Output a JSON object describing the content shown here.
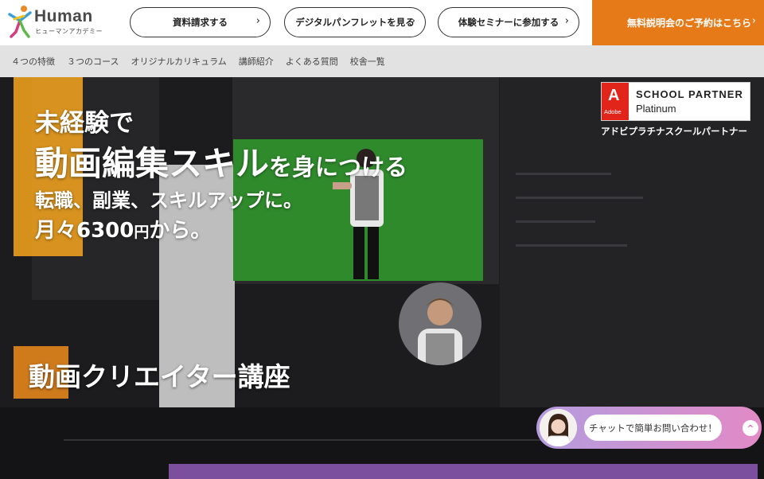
{
  "header": {
    "logo_word": "Human",
    "logo_sub": "ヒューマンアカデミー",
    "buttons": [
      {
        "label": "資料請求する",
        "chevron": "›"
      },
      {
        "label": "デジタルパンフレットを見る",
        "chevron": "›"
      },
      {
        "label": "体験セミナーに参加する",
        "chevron": "›"
      }
    ],
    "cta": {
      "label": "無料説明会のご予約はこちら",
      "chevron": "›",
      "color": "#e77a18"
    }
  },
  "nav": {
    "items": [
      "４つの特徴",
      "３つのコース",
      "オリジナルカリキュラム",
      "講師紹介",
      "よくある質問",
      "校舎一覧"
    ]
  },
  "hero": {
    "line1": "未経験で",
    "line2_big": "動画編集スキル",
    "line2_small": "を身につける",
    "line3": "転職、副業、スキルアップに。",
    "line4_a": "月々6300",
    "line4_yen": "円",
    "line4_b": "から。",
    "course_title": "動画クリエイター講座",
    "accent_color": "#f0a21e"
  },
  "badge": {
    "logo_letter": "A",
    "logo_text": "Adobe",
    "title": "SCHOOL PARTNER",
    "subtitle": "Platinum",
    "caption": "アドビプラチナスクールパートナー"
  },
  "chat": {
    "label": "チャットで簡単お問い合わせ！",
    "up_icon": "^"
  }
}
